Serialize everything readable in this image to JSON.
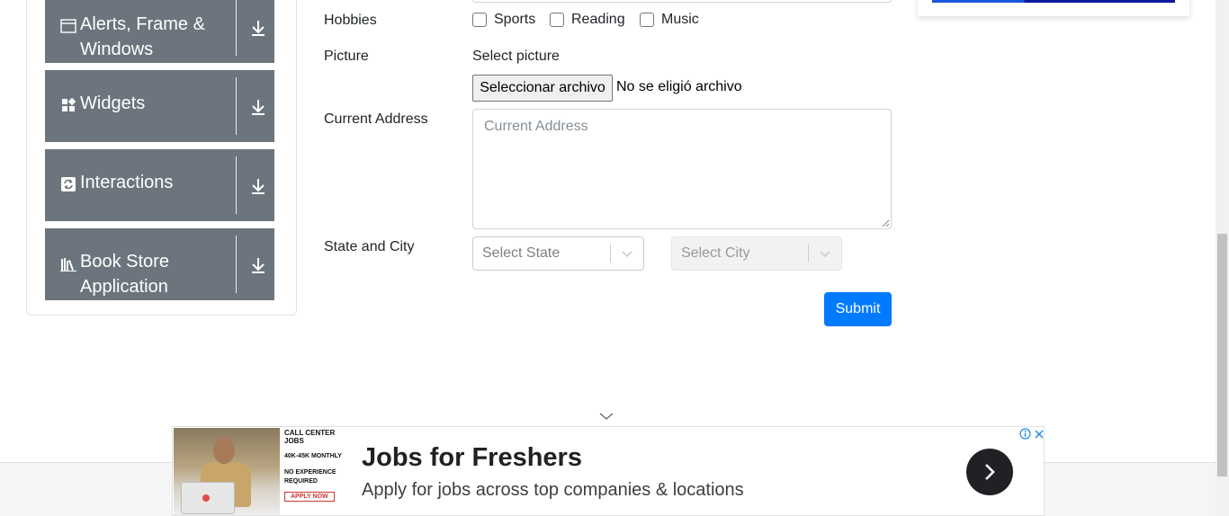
{
  "sidebar": {
    "groups": [
      {
        "label": "Alerts, Frame & Windows",
        "icon": "window-icon"
      },
      {
        "label": "Widgets",
        "icon": "widgets-icon"
      },
      {
        "label": "Interactions",
        "icon": "interactions-icon"
      },
      {
        "label": "Book Store Application",
        "icon": "books-icon"
      }
    ]
  },
  "form": {
    "hobbies_label": "Hobbies",
    "hobbies": [
      "Sports",
      "Reading",
      "Music"
    ],
    "picture_label": "Picture",
    "picture_hint": "Select picture",
    "file_button": "Seleccionar archivo",
    "file_status": "No se eligió archivo",
    "address_label": "Current Address",
    "address_placeholder": "Current Address",
    "state_city_label": "State and City",
    "state_placeholder": "Select State",
    "city_placeholder": "Select City",
    "submit": "Submit"
  },
  "ad": {
    "side_title": "CALL CENTER JOBS",
    "side_salary": "40K-45K MONTHLY",
    "side_exp": "NO EXPERIENCE REQUIRED",
    "side_apply": "APPLY NOW",
    "title": "Jobs for Freshers",
    "subtitle": "Apply for jobs across top companies & locations"
  },
  "colors": {
    "sidebar_group_bg": "#6c757d",
    "primary": "#007bff"
  }
}
